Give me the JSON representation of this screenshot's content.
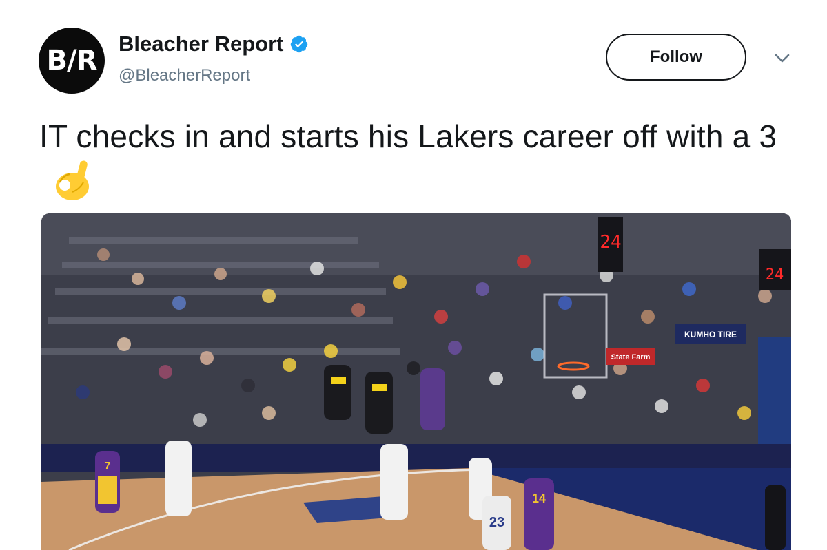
{
  "account": {
    "avatar_text": "B/R",
    "display_name": "Bleacher Report",
    "handle": "@BleacherReport",
    "verified": true,
    "verified_icon": "verified-badge-icon",
    "verified_color": "#1da1f2"
  },
  "actions": {
    "follow_label": "Follow",
    "menu_icon": "chevron-down-icon"
  },
  "tweet": {
    "text": "IT checks in and starts his Lakers career off with a 3",
    "emoji": "ok-hand-icon"
  },
  "media": {
    "type": "video-frame",
    "description_icon": "basketball-game-video-thumbnail",
    "shot_clock_1": "24",
    "shot_clock_2": "24",
    "ad_banner_1": "KUMHO TIRE",
    "ad_banner_2": "State Farm",
    "player_numbers": [
      "7",
      "14",
      "23"
    ]
  }
}
